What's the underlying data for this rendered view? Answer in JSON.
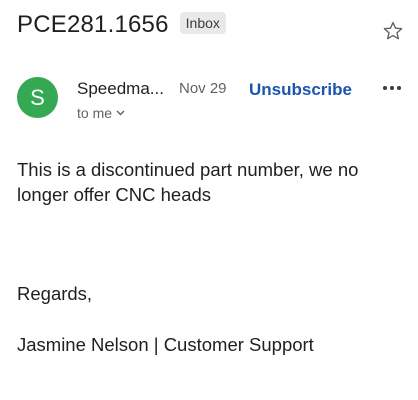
{
  "subject": "PCE281.1656",
  "label": "Inbox",
  "icons": {
    "star": "star-icon",
    "more": "more-horizontal-icon",
    "chevron": "chevron-down-icon"
  },
  "sender": {
    "avatar_letter": "S",
    "avatar_color": "#34a853",
    "name": "Speedma...",
    "date": "Nov 29",
    "unsubscribe": "Unsubscribe",
    "recipient": "to me"
  },
  "message": {
    "body": "This is a discontinued part number, we no longer offer CNC heads",
    "regards": "Regards,",
    "signature": "Jasmine Nelson | Customer Support"
  },
  "colors": {
    "link": "#1a56b0",
    "secondary_text": "#5f6368"
  }
}
